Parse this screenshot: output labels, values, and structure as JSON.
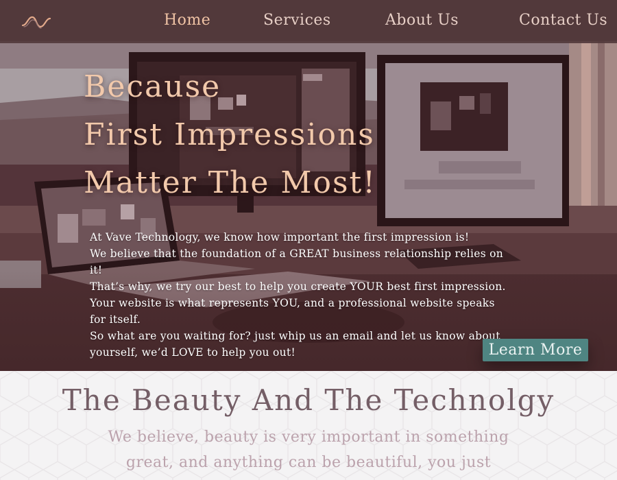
{
  "nav": {
    "logo_icon": "wave-logo-icon",
    "items": [
      {
        "label": "Home",
        "active": true
      },
      {
        "label": "Services"
      },
      {
        "label": "About Us"
      },
      {
        "label": "Contact Us"
      }
    ]
  },
  "hero": {
    "headline": [
      "Because",
      "First Impressions",
      "Matter The Most!"
    ],
    "paragraph": [
      "At Vave Technology, we know how important the first impression is!",
      "We believe that the foundation of a GREAT business relationship relies on it!",
      "That’s why, we try our best to help you create YOUR best first impression.",
      "Your website is what represents YOU, and a professional website speaks for itself.",
      "So what are you waiting for? just whip us an email and let us know about yourself, we’d LOVE to help you out!"
    ],
    "cta_label": "Learn More"
  },
  "section2": {
    "title": "The Beauty And The Technolgy",
    "text_lines": [
      "We believe, beauty is very important in something",
      "great, and anything can be beautiful, you just"
    ]
  },
  "colors": {
    "nav_bg": "#523a3c",
    "nav_active": "#f0c3a5",
    "headline": "#f2c9ab",
    "cta_bg": "#4f8582",
    "section_title": "#745e66",
    "section_text": "#bba2ac"
  }
}
